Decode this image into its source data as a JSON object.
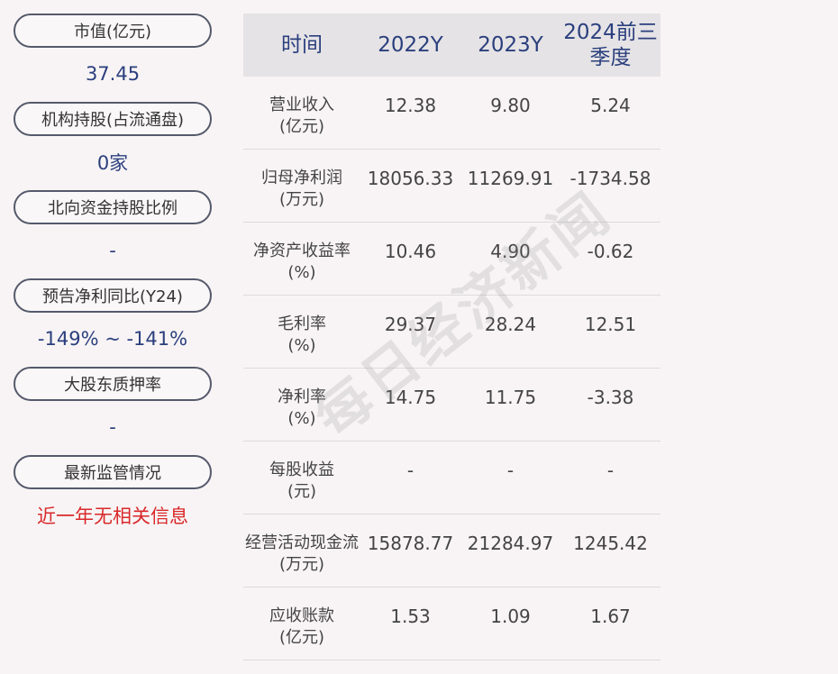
{
  "left_panel": {
    "metrics": [
      {
        "label": "市值(亿元)",
        "value": "37.45",
        "alert": false
      },
      {
        "label": "机构持股(占流通盘)",
        "value": "0家",
        "alert": false
      },
      {
        "label": "北向资金持股比例",
        "value": "-",
        "alert": false
      },
      {
        "label": "预告净利同比(Y24)",
        "value": "-149% ~ -141%",
        "alert": false
      },
      {
        "label": "大股东质押率",
        "value": "-",
        "alert": false
      },
      {
        "label": "最新监管情况",
        "value": "近一年无相关信息",
        "alert": true
      }
    ]
  },
  "table": {
    "headers": [
      "时间",
      "2022Y",
      "2023Y",
      "2024前三季度"
    ],
    "rows": [
      {
        "label_line1": "营业收入",
        "label_line2": "(亿元)",
        "values": [
          "12.38",
          "9.80",
          "5.24"
        ]
      },
      {
        "label_line1": "归母净利润",
        "label_line2": "(万元)",
        "values": [
          "18056.33",
          "11269.91",
          "-1734.58"
        ]
      },
      {
        "label_line1": "净资产收益率",
        "label_line2": "(%)",
        "values": [
          "10.46",
          "4.90",
          "-0.62"
        ]
      },
      {
        "label_line1": "毛利率",
        "label_line2": "(%)",
        "values": [
          "29.37",
          "28.24",
          "12.51"
        ]
      },
      {
        "label_line1": "净利率",
        "label_line2": "(%)",
        "values": [
          "14.75",
          "11.75",
          "-3.38"
        ]
      },
      {
        "label_line1": "每股收益",
        "label_line2": "(元)",
        "values": [
          "-",
          "-",
          "-"
        ]
      },
      {
        "label_line1": "经营活动现金流",
        "label_line2": "(万元)",
        "values": [
          "15878.77",
          "21284.97",
          "1245.42"
        ]
      },
      {
        "label_line1": "应收账款",
        "label_line2": "(亿元)",
        "values": [
          "1.53",
          "1.09",
          "1.67"
        ]
      }
    ]
  },
  "watermark": {
    "text": "每日经济新闻"
  },
  "colors": {
    "background": "#f8f4f5",
    "accent_blue": "#2b3f7e",
    "alert_red": "#d9282a",
    "header_bg": "#e5e3e5"
  }
}
